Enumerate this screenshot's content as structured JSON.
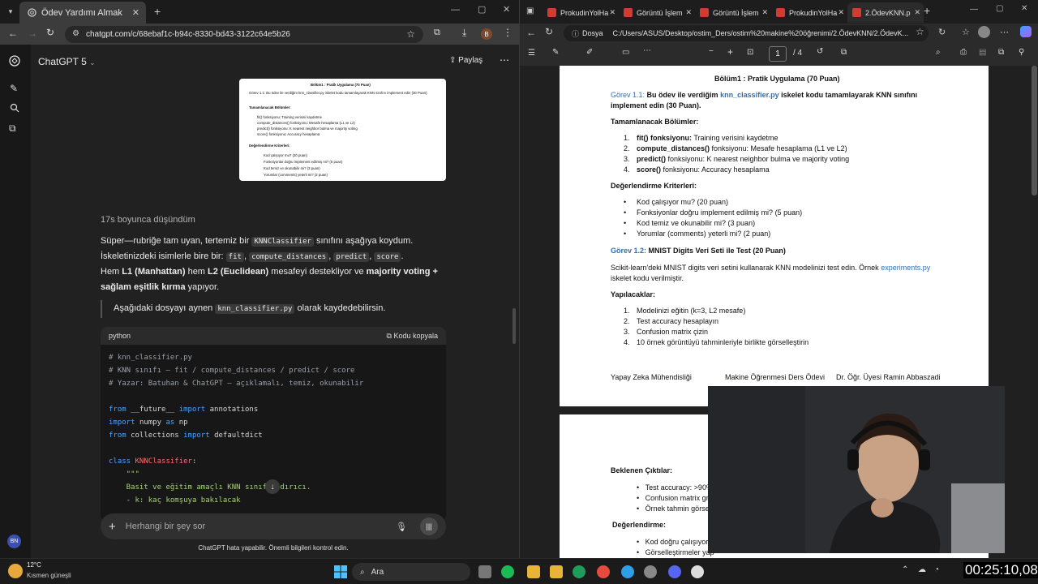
{
  "left_browser": {
    "tab_title": "Ödev Yardımı Almak",
    "url": "chatgpt.com/c/68ebaf1c-b94c-8330-bd43-3122c64e5b26",
    "profile_initial": "B"
  },
  "chatgpt": {
    "model_title": "ChatGPT 5",
    "share_label": "Paylaş",
    "thinking_text": "17s boyunca düşündüm",
    "paragraph_1": [
      "Süper—rubriğe tam uyan, tertemiz bir ",
      "KNNClassifier",
      " sınıfını aşağıya koydum."
    ],
    "paragraph_2": [
      "İskeletinizdeki isimlerle bire bir: ",
      "fit",
      ", ",
      "compute_distances",
      ", ",
      "predict",
      ", ",
      "score",
      "."
    ],
    "paragraph_3a": [
      "Hem ",
      "L1 (Manhattan)",
      " hem ",
      "L2 (Euclidean)",
      " mesafeyi destekliyor ve ",
      "majority voting +"
    ],
    "paragraph_3b": [
      "sağlam eşitlik kırma",
      " yapıyor."
    ],
    "quote": [
      "Aşağıdaki dosyayı aynen ",
      "knn_classifier.py",
      " olarak kaydedebilirsin."
    ],
    "code_lang": "python",
    "copy_label": "Kodu kopyala",
    "code_lines": [
      {
        "t": "cm",
        "v": "# knn_classifier.py"
      },
      {
        "t": "cm",
        "v": "# KNN sınıfı — fit / compute_distances / predict / score"
      },
      {
        "t": "cm",
        "v": "# Yazar: Batuhan & ChatGPT — açıklamalı, temiz, okunabilir"
      },
      {
        "t": "blank",
        "v": ""
      },
      {
        "t": "mix",
        "parts": [
          [
            "kw",
            "from "
          ],
          [
            "pl",
            "__future__ "
          ],
          [
            "kw",
            "import "
          ],
          [
            "pl",
            "annotations"
          ]
        ]
      },
      {
        "t": "mix",
        "parts": [
          [
            "kw",
            "import "
          ],
          [
            "pl",
            "numpy "
          ],
          [
            "kw",
            "as "
          ],
          [
            "pl",
            "np"
          ]
        ]
      },
      {
        "t": "mix",
        "parts": [
          [
            "kw",
            "from "
          ],
          [
            "pl",
            "collections "
          ],
          [
            "kw",
            "import "
          ],
          [
            "pl",
            "defaultdict"
          ]
        ]
      },
      {
        "t": "blank",
        "v": ""
      },
      {
        "t": "mix",
        "parts": [
          [
            "kw",
            "class "
          ],
          [
            "cl",
            "KNNClassifier"
          ],
          [
            "pl",
            ":"
          ]
        ]
      },
      {
        "t": "st",
        "v": "    \"\"\""
      },
      {
        "t": "st",
        "v": "    Basit ve eğitim amaçlı KNN sınıflandırıcı."
      },
      {
        "t": "st",
        "v": "    - k: kaç komşuya bakılacak"
      }
    ],
    "input_placeholder": "Herhangi bir şey sor",
    "disclaimer": "ChatGPT hata yapabilir. Önemli bilgileri kontrol edin.",
    "avatar_initials": "BN",
    "thumb": {
      "title": "Bölüm1 : Pratik Uygulama (70 Puan)",
      "task": "Görev 1.1: Bu ödev ile verdiğim knn_classifier.py iskelet kodu tamamlayarak KNN sınıfını implement edin (30 Puan).",
      "h1": "Tamamlanacak Bölümler:",
      "items": [
        "fit() fonksiyonu: Training verisini kaydetme",
        "compute_distances() fonksiyonu: Mesafe hesaplama (L1 ve L2)",
        "predict() fonksiyonu: K nearest neighbor bulma ve majority voting",
        "score() fonksiyonu: Accuracy hesaplama"
      ],
      "h2": "Değerlendirme Kriterleri:",
      "bullets": [
        "Kod çalışıyor mu? (20 puan)",
        "Fonksiyonlar doğru implement edilmiş mi? (5 puan)",
        "Kod temiz ve okunabilir mi? (3 puan)",
        "Yorumlar (comments) yeterli mi? (2 puan)"
      ]
    }
  },
  "right_browser": {
    "tabs": [
      "ProkudinYolHa",
      "Görüntü İşlem",
      "Görüntü İşlem",
      "ProkudinYolHa",
      "2.ÖdevKNN.p"
    ],
    "url_prefix": "Dosya",
    "url": "C:/Users/ASUS/Desktop/ostim_Ders/ostim%20makine%20öğrenimi/2.ÖdevKNN/2.ÖdevK...",
    "page_current": "1",
    "page_total": "/ 4"
  },
  "pdf": {
    "title": "Bölüm1 : Pratik Uygulama (70 Puan)",
    "task1_label": "Görev 1.1:",
    "task1_a": " Bu ödev ile verdiğim ",
    "task1_file": "knn_classifier.py",
    "task1_b": " iskelet kodu tamamlayarak KNN sınıfını",
    "task1_c": "implement edin (30 Puan).",
    "sec1": "Tamamlanacak Bölümler:",
    "items": [
      {
        "n": "1.",
        "b": "fit() fonksiyonu:",
        "r": " Training verisini kaydetme"
      },
      {
        "n": "2.",
        "b": "compute_distances()",
        "r": " fonksiyonu: Mesafe hesaplama (L1 ve L2)"
      },
      {
        "n": "3.",
        "b": "predict()",
        "r": " fonksiyonu: K nearest neighbor bulma ve majority voting"
      },
      {
        "n": "4.",
        "b": "score()",
        "r": " fonksiyonu: Accuracy hesaplama"
      }
    ],
    "sec2": "Değerlendirme Kriterleri:",
    "bullets": [
      "Kod çalışıyor mu? (20 puan)",
      "Fonksiyonlar doğru implement edilmiş mi? (5 puan)",
      "Kod temiz ve okunabilir mi? (3 puan)",
      "Yorumlar (comments) yeterli mi? (2 puan)"
    ],
    "task2_label": "Görev 1.2:",
    "task2_title": " MNIST Digits Veri Seti ile Test (20 Puan)",
    "task2_p1a": "Scikit-learn'deki MNIST digits veri setini kullanarak KNN modelinizi test edin. Örnek ",
    "task2_file": "experiments.py",
    "task2_p1b": "iskelet kodu verilmiştir.",
    "sec3": "Yapılacaklar:",
    "todo": [
      "Modelinizi eğitin (k=3, L2 mesafe)",
      "Test accuracy hesaplayın",
      "Confusion matrix çizin",
      "10 örnek görüntüyü tahminleriyle birlikte görselleştirin"
    ],
    "footer": [
      "Yapay Zeka Mühendisliği",
      "Makine Öğrenmesi Ders Ödevi",
      "Dr. Öğr. Üyesi Ramin Abbaszadi"
    ],
    "p2_sec1": "Beklenen Çıktılar:",
    "p2_bullets": [
      "Test accuracy: >90%",
      "Confusion matrix grafi",
      "Örnek tahmin görselle"
    ],
    "p2_sec2": "Değerlendirme:",
    "p2_bullets2": [
      "Kod doğru çalışıyor (1",
      "Görselleştirmeler yap"
    ]
  },
  "taskbar": {
    "weather_temp": "12°C",
    "weather_desc": "Kısmen güneşli",
    "search_label": "Ara",
    "clock": "00:25:10,08"
  },
  "colors": {
    "accent_blue": "#2f6fb5",
    "chatgpt_bg": "#212121",
    "code_bg": "#171717"
  }
}
